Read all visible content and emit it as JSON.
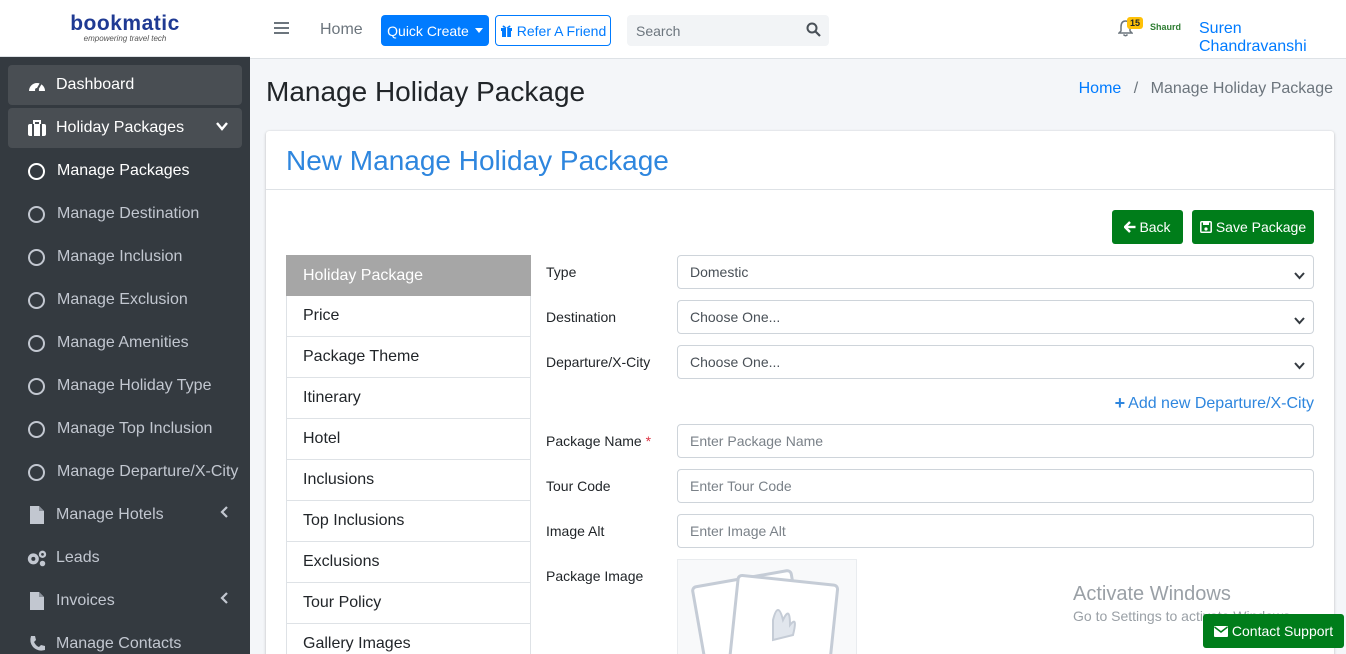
{
  "brand": {
    "name": "bookmatic",
    "tagline": "empowering travel tech"
  },
  "sidebar": {
    "items": [
      {
        "label": "Dashboard"
      },
      {
        "label": "Holiday Packages"
      },
      {
        "label": "Manage Packages"
      },
      {
        "label": "Manage Destination"
      },
      {
        "label": "Manage Inclusion"
      },
      {
        "label": "Manage Exclusion"
      },
      {
        "label": "Manage Amenities"
      },
      {
        "label": "Manage Holiday Type"
      },
      {
        "label": "Manage Top Inclusion"
      },
      {
        "label": "Manage Departure/X-City"
      },
      {
        "label": "Manage Hotels"
      },
      {
        "label": "Leads"
      },
      {
        "label": "Invoices"
      },
      {
        "label": "Manage Contacts"
      }
    ]
  },
  "topbar": {
    "home": "Home",
    "quick_create": "Quick Create",
    "refer": "Refer A Friend",
    "search_placeholder": "Search",
    "notification_count": "15",
    "partner_logo": "Shaurd",
    "user_name": "Suren Chandravanshi"
  },
  "header": {
    "title": "Manage Holiday Package",
    "breadcrumb_home": "Home",
    "breadcrumb_current": "Manage Holiday Package"
  },
  "card": {
    "title": "New Manage Holiday Package",
    "back_label": "Back",
    "save_label": "Save Package"
  },
  "tabs": [
    "Holiday Package",
    "Price",
    "Package Theme",
    "Itinerary",
    "Hotel",
    "Inclusions",
    "Top Inclusions",
    "Exclusions",
    "Tour Policy",
    "Gallery Images"
  ],
  "form": {
    "type_label": "Type",
    "type_value": "Domestic",
    "destination_label": "Destination",
    "destination_value": "Choose One...",
    "departure_label": "Departure/X-City",
    "departure_value": "Choose One...",
    "add_departure": "Add new Departure/X-City",
    "package_name_label": "Package Name",
    "package_name_placeholder": "Enter Package Name",
    "tour_code_label": "Tour Code",
    "tour_code_placeholder": "Enter Tour Code",
    "image_alt_label": "Image Alt",
    "image_alt_placeholder": "Enter Image Alt",
    "package_image_label": "Package Image"
  },
  "watermark": {
    "title": "Activate Windows",
    "subtitle": "Go to Settings to activate Windows."
  },
  "contact_support": "Contact Support",
  "colors": {
    "primary": "#007bff",
    "success": "#007d1a",
    "sidebar": "#343a40",
    "title": "#2e86de"
  }
}
